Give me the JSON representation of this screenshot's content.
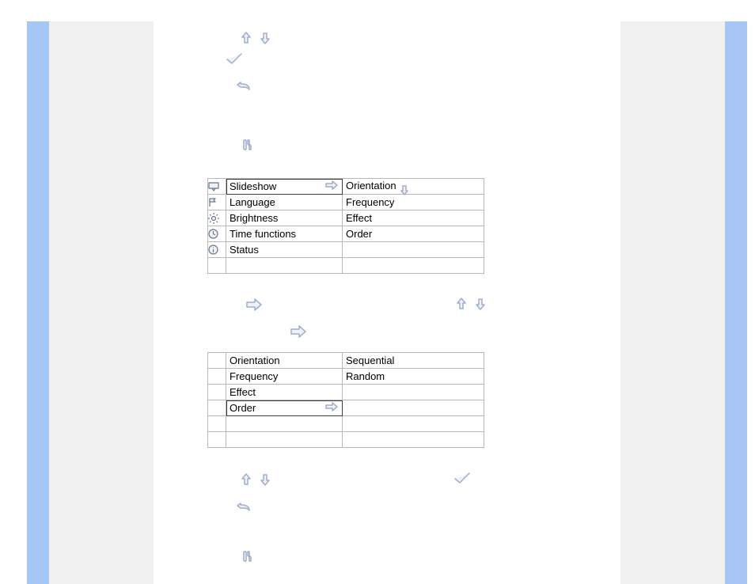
{
  "menu1": {
    "left": [
      {
        "icon": "projector",
        "label": "Slideshow",
        "selected": true
      },
      {
        "icon": "flag",
        "label": "Language"
      },
      {
        "icon": "brightness",
        "label": "Brightness"
      },
      {
        "icon": "clock",
        "label": "Time functions"
      },
      {
        "icon": "info",
        "label": "Status"
      }
    ],
    "right": [
      "Orientation",
      "Frequency",
      "Effect",
      "Order"
    ]
  },
  "menu2": {
    "left": [
      "Orientation",
      "Frequency",
      "Effect",
      "Order"
    ],
    "selected_index": 3,
    "right": [
      "Sequential",
      "Random"
    ]
  }
}
